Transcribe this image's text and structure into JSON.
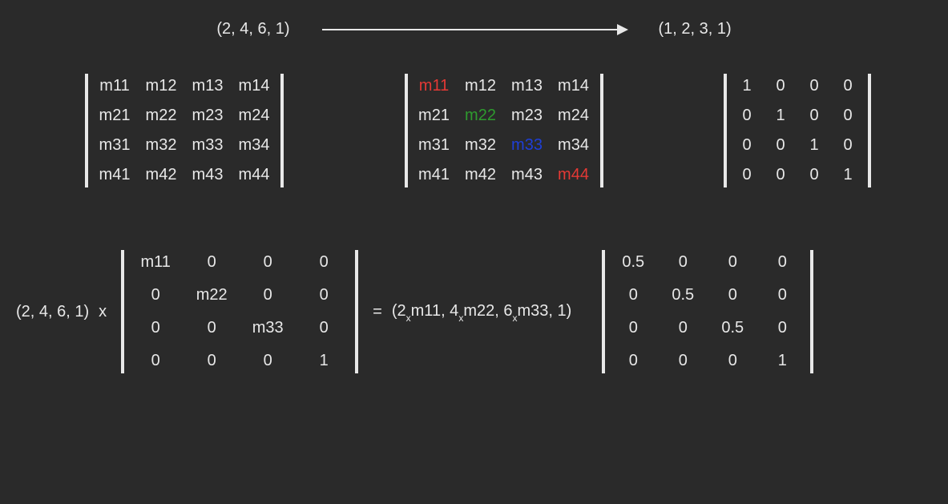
{
  "header": {
    "left_tuple": "(2, 4, 6, 1)",
    "right_tuple": "(1, 2, 3, 1)"
  },
  "matrix_labels": {
    "generic": [
      [
        "m11",
        "m12",
        "m13",
        "m14"
      ],
      [
        "m21",
        "m22",
        "m23",
        "m24"
      ],
      [
        "m31",
        "m32",
        "m33",
        "m34"
      ],
      [
        "m41",
        "m42",
        "m43",
        "m44"
      ]
    ],
    "highlighted_cells": {
      "0,0": "red",
      "1,1": "green",
      "2,2": "blue",
      "3,3": "red"
    },
    "identity": [
      [
        "1",
        "0",
        "0",
        "0"
      ],
      [
        "0",
        "1",
        "0",
        "0"
      ],
      [
        "0",
        "0",
        "1",
        "0"
      ],
      [
        "0",
        "0",
        "0",
        "1"
      ]
    ]
  },
  "equation": {
    "vector": "(2, 4, 6, 1)",
    "times": "x",
    "diag_matrix": [
      [
        "m11",
        "0",
        "0",
        "0"
      ],
      [
        "0",
        "m22",
        "0",
        "0"
      ],
      [
        "0",
        "0",
        "m33",
        "0"
      ],
      [
        "0",
        "0",
        "0",
        "1"
      ]
    ],
    "equals": "=",
    "result_prefix": "(2",
    "result_m11": "m11, 4",
    "result_m22": "m22, 6",
    "result_m33": "m33, 1)",
    "sub_x": "x",
    "half_matrix": [
      [
        "0.5",
        "0",
        "0",
        "0"
      ],
      [
        "0",
        "0.5",
        "0",
        "0"
      ],
      [
        "0",
        "0",
        "0.5",
        "0"
      ],
      [
        "0",
        "0",
        "0",
        "1"
      ]
    ]
  },
  "colors": {
    "red": "#e53935",
    "green": "#2e9b2e",
    "blue": "#1e3fd8"
  }
}
